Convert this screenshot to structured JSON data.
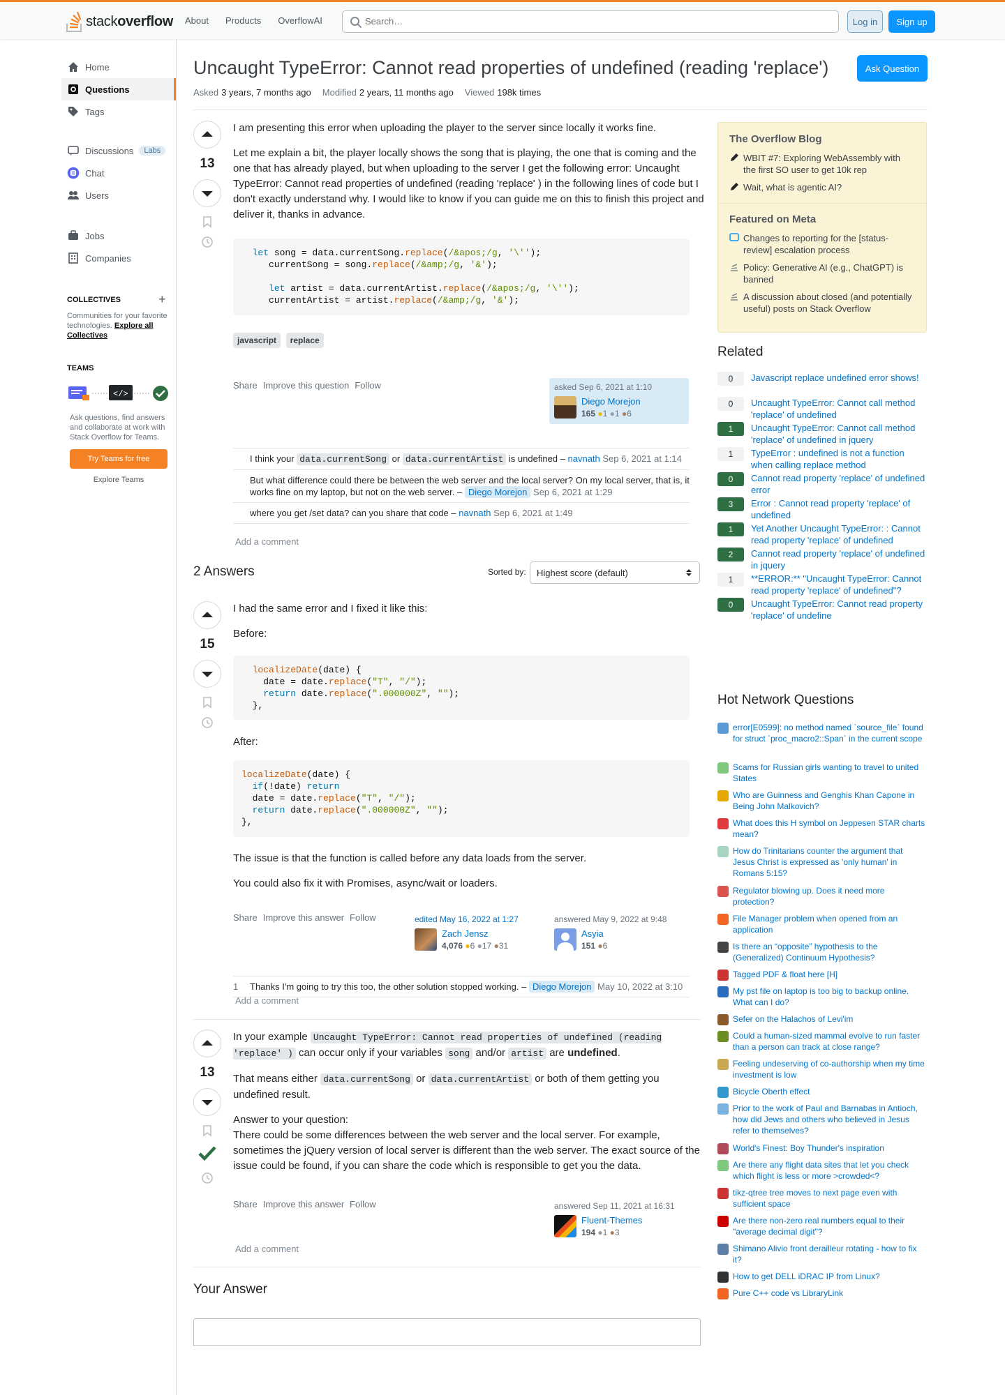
{
  "header": {
    "logo_prefix": "stack",
    "logo_suffix": "overflow",
    "nav": [
      "About",
      "Products",
      "OverflowAI"
    ],
    "search_placeholder": "Search…",
    "login": "Log in",
    "signup": "Sign up"
  },
  "leftnav": {
    "items": [
      "Home",
      "Questions",
      "Tags",
      "Discussions",
      "Chat",
      "Users",
      "Jobs",
      "Companies"
    ],
    "labs": "Labs",
    "collectives_title": "COLLECTIVES",
    "collectives_text": "Communities for your favorite technologies.",
    "collectives_link": "Explore all Collectives",
    "teams_title": "TEAMS",
    "teams_text": "Ask questions, find answers and collaborate at work with Stack Overflow for Teams.",
    "teams_button": "Try Teams for free",
    "teams_explore": "Explore Teams"
  },
  "question": {
    "title": "Uncaught TypeError: Cannot read properties of undefined (reading 'replace')",
    "ask_button": "Ask Question",
    "asked_label": "Asked",
    "asked": "3 years, 7 months ago",
    "modified_label": "Modified",
    "modified": "2 years, 11 months ago",
    "viewed_label": "Viewed",
    "viewed": "198k times",
    "score": "13",
    "body": [
      "I am presenting this error when uploading the player to the server since locally it works fine.",
      "Let me explain a bit, the player locally shows the song that is playing, the one that is coming and the one that has already played, but when uploading to the server I get the following error: Uncaught TypeError: Cannot read properties of undefined (reading 'replace' ) in the following lines of code but I don't exactly understand why. I would like to know if you can guide me on this to finish this project and deliver it, thanks in advance."
    ],
    "tags": [
      "javascript",
      "replace"
    ],
    "menu": [
      "Share",
      "Improve this question",
      "Follow"
    ],
    "asked_card": "asked Sep 6, 2021 at 1:10",
    "user": {
      "name": "Diego Morejon",
      "rep": "165",
      "gold": "1",
      "silver": "1",
      "bronze": "6"
    },
    "comments": [
      {
        "pre": "I think your",
        "c1": "data.currentSong",
        "mid": "or",
        "c2": "data.currentArtist",
        "post": "is undefined –",
        "user": "navnath",
        "date": "Sep 6, 2021 at 1:14"
      },
      {
        "text": "But what difference could there be between the web server and the local server? On my local server, that is, it works fine on my laptop, but not on the web server. –",
        "user": "Diego Morejon",
        "date": "Sep 6, 2021 at 1:29"
      },
      {
        "text": "where you get /set data? can you share that code –",
        "user": "navnath",
        "date": "Sep 6, 2021 at 1:49"
      }
    ],
    "add_comment": "Add a comment"
  },
  "answers_header": {
    "count": "2 Answers",
    "sorted_by": "Sorted by:",
    "sort_value": "Highest score (default)"
  },
  "answer1": {
    "score": "15",
    "p1": "I had the same error and I fixed it like this:",
    "before": "Before:",
    "after": "After:",
    "p2": "The issue is that the function is called before any data loads from the server.",
    "p3": "You could also fix it with Promises, async/wait or loaders.",
    "menu": [
      "Share",
      "Improve this answer",
      "Follow"
    ],
    "edited": "edited May 16, 2022 at 1:27",
    "editor": {
      "name": "Zach Jensz",
      "rep": "4,076",
      "gold": "6",
      "silver": "17",
      "bronze": "31"
    },
    "answered": "answered May 9, 2022 at 9:48",
    "user": {
      "name": "Asyia",
      "rep": "151",
      "bronze": "6"
    },
    "comment": {
      "score": "1",
      "text": "Thanks I'm going to try this too, the other solution stopped working. –",
      "user": "Diego Morejon",
      "date": "May 10, 2022 at 3:10"
    },
    "add_comment": "Add a comment"
  },
  "answer2": {
    "score": "13",
    "p1_pre": "In your example",
    "p1_code": "Uncaught TypeError: Cannot read properties of undefined (reading 'replace' )",
    "p1_mid": "can occur only if your variables",
    "p1_c1": "song",
    "p1_and": "and/or",
    "p1_c2": "artist",
    "p1_are": "are",
    "p1_bold": "undefined",
    "p2_pre": "That means either",
    "p2_c1": "data.currentSong",
    "p2_or": "or",
    "p2_c2": "data.currentArtist",
    "p2_post": "or both of them getting you undefined result.",
    "p3_head": "Answer to your question:",
    "p3": "There could be some differences between the web server and the local server. For example, sometimes the jQuery version of local server is different than the web server. The exact source of the issue could be found, if you can share the code which is responsible to get you the data.",
    "menu": [
      "Share",
      "Improve this answer",
      "Follow"
    ],
    "answered": "answered Sep 11, 2021 at 16:31",
    "user": {
      "name": "Fluent-Themes",
      "rep": "194",
      "silver": "1",
      "bronze": "3"
    },
    "add_comment": "Add a comment"
  },
  "your_answer": "Your Answer",
  "sidebar": {
    "blog_title": "The Overflow Blog",
    "blog_items": [
      "WBIT #7: Exploring WebAssembly with the first SO user to get 10k rep",
      "Wait, what is agentic AI?"
    ],
    "meta_title": "Featured on Meta",
    "meta_items": [
      "Changes to reporting for the [status-review] escalation process",
      "Policy: Generative AI (e.g., ChatGPT) is banned",
      "A discussion about closed (and potentially useful) posts on Stack Overflow"
    ],
    "related_title": "Related",
    "related": [
      {
        "score": "0",
        "accepted": false,
        "title": "Javascript replace undefined error shows!"
      },
      {
        "score": "0",
        "accepted": false,
        "title": "Uncaught TypeError: Cannot call method 'replace' of undefined"
      },
      {
        "score": "1",
        "accepted": true,
        "title": "Uncaught TypeError: Cannot call method 'replace' of undefined in jquery"
      },
      {
        "score": "1",
        "accepted": false,
        "title": "TypeError : undefined is not a function when calling replace method"
      },
      {
        "score": "0",
        "accepted": true,
        "title": "Cannot read property 'replace' of undefined error"
      },
      {
        "score": "3",
        "accepted": true,
        "title": "Error : Cannot read property 'replace' of undefined"
      },
      {
        "score": "1",
        "accepted": true,
        "title": "Yet Another Uncaught TypeError: : Cannot read property 'replace' of undefined"
      },
      {
        "score": "2",
        "accepted": true,
        "title": "Cannot read property 'replace' of undefined in jquery"
      },
      {
        "score": "1",
        "accepted": false,
        "title": "**ERROR:** \"Uncaught TypeError: Cannot read property 'replace' of undefined\"?"
      },
      {
        "score": "0",
        "accepted": true,
        "title": "Uncaught TypeError: Cannot read property 'replace' of undefine"
      }
    ],
    "hnq_title": "Hot Network Questions",
    "hnq": [
      {
        "color": "#5b9bd5",
        "title": "error[E0599]: no method named `source_file` found for struct `proc_macro2::Span` in the current scope"
      },
      {
        "color": "#7fc97f",
        "title": "Scams for Russian girls wanting to travel to united States"
      },
      {
        "color": "#e6a700",
        "title": "Who are Guinness and Genghis Khan Capone in Being John Malkovich?"
      },
      {
        "color": "#e03a3e",
        "title": "What does this H symbol on Jeppesen STAR charts mean?"
      },
      {
        "color": "#a8d5c2",
        "title": "How do Trinitarians counter the argument that Jesus Christ is expressed as 'only human' in Romans 5:15?"
      },
      {
        "color": "#d9534f",
        "title": "Regulator blowing up. Does it need more protection?"
      },
      {
        "color": "#f26522",
        "title": "File Manager problem when opened from an application"
      },
      {
        "color": "#444444",
        "title": "Is there an “opposite” hypothesis to the (Generalized) Continuum Hypothesis?"
      },
      {
        "color": "#cc3333",
        "title": "Tagged PDF & float here [H]"
      },
      {
        "color": "#2a6ebb",
        "title": "My pst file on laptop is too big to backup online. What can I do?"
      },
      {
        "color": "#8b5a2b",
        "title": "Sefer on the Halachos of Levi'im"
      },
      {
        "color": "#6b8e23",
        "title": "Could a human-sized mammal evolve to run faster than a person can track at close range?"
      },
      {
        "color": "#c8a951",
        "title": "Feeling undeserving of co-authorship when my time investment is low"
      },
      {
        "color": "#3399cc",
        "title": "Bicycle Oberth effect"
      },
      {
        "color": "#7ab3e0",
        "title": "Prior to the work of Paul and Barnabas in Antioch, how did Jews and others who believed in Jesus refer to themselves?"
      },
      {
        "color": "#b04a5a",
        "title": "World's Finest: Boy Thunder's inspiration"
      },
      {
        "color": "#7fc97f",
        "title": "Are there any flight data sites that let you check which flight is less or more >crowded<?"
      },
      {
        "color": "#cc3333",
        "title": "tikz-qtree tree moves to next page even with sufficient space"
      },
      {
        "color": "#cc0000",
        "title": "Are there non-zero real numbers equal to their \"average decimal digit\"?"
      },
      {
        "color": "#5b7fa6",
        "title": "Shimano Alivio front derailleur rotating - how to fix it?"
      },
      {
        "color": "#333333",
        "title": "How to get DELL iDRAC IP from Linux?"
      },
      {
        "color": "#f26522",
        "title": "Pure C++ code vs LibraryLink"
      }
    ]
  }
}
